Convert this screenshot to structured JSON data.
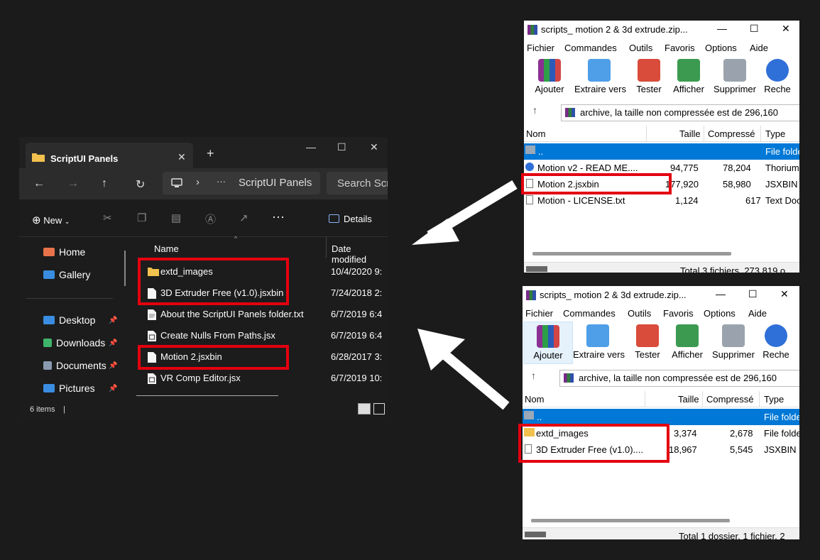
{
  "explorer": {
    "tab_title": "ScriptUI Panels",
    "close_glyph": "✕",
    "newtab_glyph": "+",
    "window_controls": [
      "—",
      "☐",
      "✕"
    ],
    "address_text": "ScriptUI Panels",
    "address_sep": "›",
    "address_more": "···",
    "search_placeholder": "Search Scr",
    "toolbar": {
      "new_label": "New",
      "more_label": "···",
      "details_label": "Details"
    },
    "sidebar": [
      {
        "label": "Home",
        "icon": "home-icon",
        "color": "#e8734a",
        "pinned": false
      },
      {
        "label": "Gallery",
        "icon": "gallery-icon",
        "color": "#3a8de0",
        "pinned": false
      },
      {
        "label": "Desktop",
        "icon": "desktop-icon",
        "color": "#3a8de0",
        "pinned": true
      },
      {
        "label": "Downloads",
        "icon": "download-icon",
        "color": "#3fb56b",
        "pinned": true
      },
      {
        "label": "Documents",
        "icon": "documents-icon",
        "color": "#8a9bb0",
        "pinned": true
      },
      {
        "label": "Pictures",
        "icon": "pictures-icon",
        "color": "#3a8de0",
        "pinned": true
      }
    ],
    "columns": {
      "name": "Name",
      "date": "Date modified"
    },
    "files": [
      {
        "name": "extd_images",
        "date": "10/4/2020 9:",
        "type": "folder"
      },
      {
        "name": "3D Extruder Free (v1.0).jsxbin",
        "date": "7/24/2018 2:",
        "type": "file"
      },
      {
        "name": "About the ScriptUI Panels folder.txt",
        "date": "6/7/2019 6:4",
        "type": "file"
      },
      {
        "name": "Create Nulls From Paths.jsx",
        "date": "6/7/2019 6:4",
        "type": "script"
      },
      {
        "name": "Motion 2.jsxbin",
        "date": "6/28/2017 3:",
        "type": "file"
      },
      {
        "name": "VR Comp Editor.jsx",
        "date": "6/7/2019 10:",
        "type": "script"
      }
    ],
    "status": "6 items",
    "status_sep": "|"
  },
  "rar_top": {
    "title": "scripts_  motion 2 & 3d extrude.zip...",
    "menu": [
      "Fichier",
      "Commandes",
      "Outils",
      "Favoris",
      "Options",
      "Aide"
    ],
    "toolbar": [
      "Ajouter",
      "Extraire vers",
      "Tester",
      "Afficher",
      "Supprimer",
      "Reche"
    ],
    "path": "archive, la taille non compressée est de 296,160",
    "columns": {
      "name": "Nom",
      "size": "Taille",
      "packed": "Compressé",
      "type": "Type"
    },
    "rows": [
      {
        "name": "..",
        "size": "",
        "packed": "",
        "type": "File folde",
        "selected": true
      },
      {
        "name": "Motion v2 - READ ME....",
        "size": "94,775",
        "packed": "78,204",
        "type": "Thorium"
      },
      {
        "name": "Motion 2.jsxbin",
        "size": "177,920",
        "packed": "58,980",
        "type": "JSXBIN f"
      },
      {
        "name": "Motion - LICENSE.txt",
        "size": "1,124",
        "packed": "617",
        "type": "Text Doc"
      }
    ],
    "status": "Total 3 fichiers, 273,819 o"
  },
  "rar_bottom": {
    "title": "scripts_  motion 2 & 3d extrude.zip...",
    "menu": [
      "Fichier",
      "Commandes",
      "Outils",
      "Favoris",
      "Options",
      "Aide"
    ],
    "toolbar": [
      "Ajouter",
      "Extraire vers",
      "Tester",
      "Afficher",
      "Supprimer",
      "Reche"
    ],
    "path": "archive, la taille non compressée est de 296,160",
    "columns": {
      "name": "Nom",
      "size": "Taille",
      "packed": "Compressé",
      "type": "Type"
    },
    "rows": [
      {
        "name": "..",
        "size": "",
        "packed": "",
        "type": "File folde",
        "selected": true
      },
      {
        "name": "extd_images",
        "size": "3,374",
        "packed": "2,678",
        "type": "File folde"
      },
      {
        "name": "3D Extruder Free (v1.0)....",
        "size": "18,967",
        "packed": "5,545",
        "type": "JSXBIN F"
      }
    ],
    "status": "Total 1 dossier, 1 fichier, 2"
  },
  "colors": {
    "highlight": "#e4000f",
    "selection": "#0078d7",
    "arrow": "#ffffff"
  }
}
